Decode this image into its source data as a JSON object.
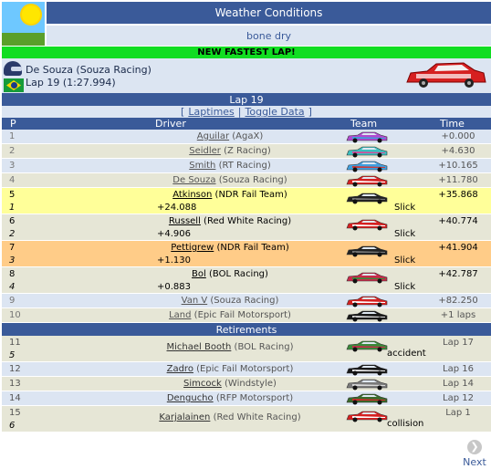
{
  "weather": {
    "title": "Weather Conditions",
    "condition": "bone dry",
    "icon": "sun-icon"
  },
  "fastest_lap": {
    "banner": "NEW FASTEST LAP!",
    "driver_line": "De Souza (Souza Racing)",
    "lap_line": "Lap 19 (1:27.994)"
  },
  "lap": {
    "title": "Lap 19",
    "link_open": "[",
    "laptimes_label": "Laptimes",
    "link_sep": "|",
    "toggle_label": "Toggle Data",
    "link_close": "]",
    "columns": {
      "p": "P",
      "driver": "Driver",
      "team": "Team",
      "time": "Time"
    }
  },
  "colors": {
    "header": "#3a5a99",
    "light": "#dce5f2",
    "alt": "#e6e6d6",
    "highlight_yellow": "#ffff99",
    "highlight_orange": "#ffcc88",
    "banner_green": "#11dd22"
  },
  "rows": [
    {
      "pos": "1",
      "name": "Aguilar",
      "team": "(AgaX)",
      "time": "+0.000"
    },
    {
      "pos": "2",
      "name": "Seidler",
      "team": "(Z Racing)",
      "time": "+4.630"
    },
    {
      "pos": "3",
      "name": "Smith",
      "team": "(RT Racing)",
      "time": "+10.165"
    },
    {
      "pos": "4",
      "name": "De Souza",
      "team": "(Souza Racing)",
      "time": "+11.780"
    },
    {
      "pos": "5",
      "name": "Atkinson",
      "team": "(NDR Fail Team)",
      "time": "+35.868",
      "prev": "1",
      "gap": "+24.088",
      "note": "Slick"
    },
    {
      "pos": "6",
      "name": "Russell",
      "team": "(Red White Racing)",
      "time": "+40.774",
      "prev": "2",
      "gap": "+4.906",
      "note": "Slick"
    },
    {
      "pos": "7",
      "name": "Pettigrew",
      "team": "(NDR Fail Team)",
      "time": "+41.904",
      "prev": "3",
      "gap": "+1.130",
      "note": "Slick"
    },
    {
      "pos": "8",
      "name": "Bol",
      "team": "(BOL Racing)",
      "time": "+42.787",
      "prev": "4",
      "gap": "+0.883",
      "note": "Slick"
    },
    {
      "pos": "9",
      "name": "Van V",
      "team": "(Souza Racing)",
      "time": "+82.250"
    },
    {
      "pos": "10",
      "name": "Land",
      "team": "(Epic Fail Motorsport)",
      "time": "+1 laps"
    }
  ],
  "retirements": {
    "title": "Retirements",
    "rows": [
      {
        "pos": "11",
        "prev": "5",
        "name": "Michael Booth",
        "team": "(BOL Racing)",
        "note": "accident",
        "time": "Lap 17"
      },
      {
        "pos": "12",
        "name": "Zadro",
        "team": "(Epic Fail Motorsport)",
        "time": "Lap 16"
      },
      {
        "pos": "13",
        "name": "Simcock",
        "team": "(Windstyle)",
        "time": "Lap 14"
      },
      {
        "pos": "14",
        "name": "Dengucho",
        "team": "(RFP Motorsport)",
        "time": "Lap 12"
      },
      {
        "pos": "15",
        "prev": "6",
        "name": "Karjalainen",
        "team": "(Red White Racing)",
        "note": "collision",
        "time": "Lap 1"
      }
    ]
  },
  "nav": {
    "next_label": "Next"
  }
}
